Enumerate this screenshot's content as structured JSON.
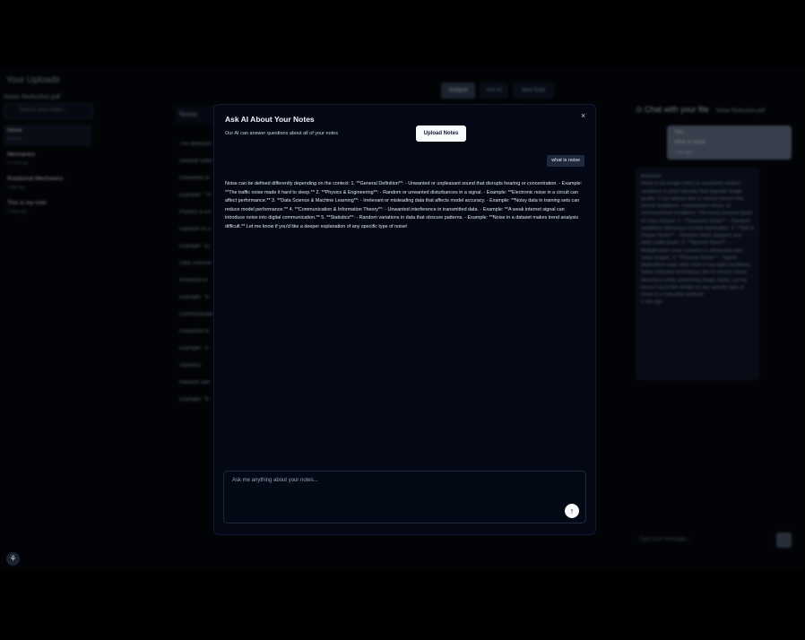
{
  "background": {
    "sidebar": {
      "title": "Your Uploads",
      "current_file": "Noise Reduction.pdf",
      "search_placeholder": "Search your notes...",
      "items": [
        {
          "name": "Noise",
          "time": "just now"
        },
        {
          "name": "Mechanics",
          "time": "2 hours ago"
        },
        {
          "name": "Rotational Mechanics",
          "time": "1 day ago"
        },
        {
          "name": "This is my note",
          "time": "2 days ago"
        }
      ]
    },
    "tabs": [
      "Analyze",
      "Ask AI",
      "New Note"
    ],
    "notes_header": "Noise",
    "note_lines": [
      "The definition",
      "General Defin",
      "Unwanted or",
      "Example: \"Th",
      "Physics & En",
      "Random or u",
      "Example: \"El",
      "Data Science",
      "Irrelevant or",
      "Example: \"N",
      "Communicatio",
      "Unwanted in",
      "Example: \"A",
      "Statistics",
      "Random vari",
      "Example: \"N"
    ],
    "chat": {
      "title": "Chat with your file",
      "file": "Noise Reduction.pdf",
      "user_label": "You",
      "user_message": "what is noise",
      "user_time": "1 min ago",
      "assistant_label": "Assistant",
      "assistant_message": "Noise in an image refers to unwanted random variations in pixel intensity that degrade image quality. It can appear due to various factors like sensor limitations, transmission errors, or environmental conditions. The most common types of noise include: 1. **Gaussian Noise** – Random variations following a normal distribution. 2. **Salt & Pepper Noise** – Random black (pepper) and white (salt) pixels. 3. **Speckle Noise** – Multiplicative noise common in ultrasound and radar images. 4. **Poisson Noise** – Signal-dependent noise often seen in low-light conditions. Noise reduction techniques aim to remove these distortions while preserving image clarity. Let me know if you'd like details on any specific type of noise or a reduction method!",
      "assistant_time": "1 min ago",
      "input_placeholder": "Type your message..."
    }
  },
  "modal": {
    "title": "Ask AI About Your Notes",
    "subtitle": "Our AI can answer questions about all of your notes",
    "upload_button": "Upload Notes",
    "close": "×",
    "question": "what is noise",
    "answer": "Noise can be defined differently depending on the context: 1. **General Definition**: - Unwanted or unpleasant sound that disrupts hearing or concentration. - Example: **The traffic noise made it hard to sleep.** 2. **Physics & Engineering**: - Random or unwanted disturbances in a signal. - Example: **Electronic noise in a circuit can affect performance.** 3. **Data Science & Machine Learning**: - Irrelevant or misleading data that affects model accuracy. - Example: **Noisy data in training sets can reduce model performance.** 4. **Communication & Information Theory**: - Unwanted interference in transmitted data. - Example: **A weak internet signal can introduce noise into digital communication.** 5. **Statistics**: - Random variations in data that obscure patterns. - Example: **Noise in a dataset makes trend analysis difficult.** Let me know if you'd like a deeper explanation of any specific type of noise!",
    "input_placeholder": "Ask me anything about your notes...",
    "send_icon": "↑"
  },
  "bot_icon": "⚘"
}
